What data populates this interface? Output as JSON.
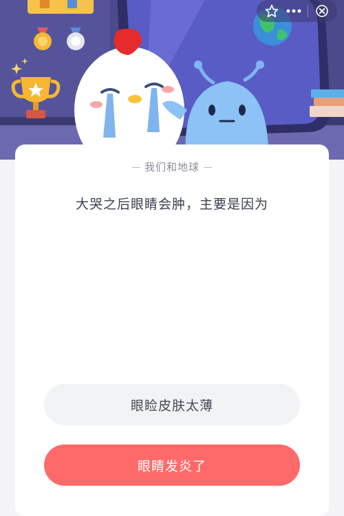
{
  "quiz": {
    "category": "我们和地球",
    "question": "大哭之后眼睛会肿，主要是因为",
    "options": [
      "眼睑皮肤太薄",
      "眼睛发炎了"
    ]
  },
  "top_actions": {
    "icons": [
      "star-outline-icon",
      "more-dots-icon",
      "close-icon"
    ]
  },
  "colors": {
    "scene_background": "#4e4c8e",
    "card_background": "#ffffff",
    "option_default": "#f2f3f5",
    "option_selected": "#fe6a6a"
  }
}
